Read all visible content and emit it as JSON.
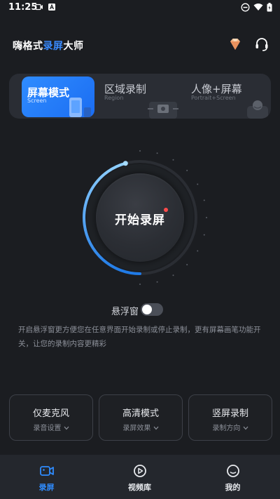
{
  "status_bar": {
    "time": "11:25"
  },
  "header": {
    "title_prefix": "嗨格式",
    "title_accent": "录屏",
    "title_suffix": "大师"
  },
  "modes": [
    {
      "label": "屏幕模式",
      "sub": "Screen",
      "active": true
    },
    {
      "label": "区域录制",
      "sub": "Region",
      "active": false
    },
    {
      "label": "人像+屏幕",
      "sub": "Portrait+Screen",
      "active": false
    }
  ],
  "record": {
    "label": "开始录屏"
  },
  "floating_window": {
    "label": "悬浮窗",
    "enabled": false
  },
  "description": "开启悬浮窗更方便您在任意界面开始录制或停止录制，更有屏幕画笔功能开关，让您的录制内容更精彩",
  "options": [
    {
      "title": "仅麦克风",
      "sub": "录音设置"
    },
    {
      "title": "高清模式",
      "sub": "录屏效果"
    },
    {
      "title": "竖屏录制",
      "sub": "录制方向"
    }
  ],
  "tabs": [
    {
      "label": "录屏",
      "active": true
    },
    {
      "label": "视频库",
      "active": false
    },
    {
      "label": "我的",
      "active": false
    }
  ],
  "colors": {
    "accent": "#2f8cff",
    "background": "#1b1d21",
    "record_dot": "#ff4b4b"
  }
}
